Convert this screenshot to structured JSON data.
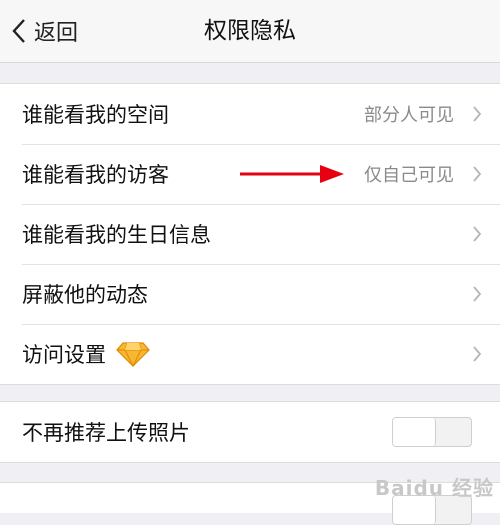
{
  "navbar": {
    "back_label": "返回",
    "title": "权限隐私"
  },
  "group1": [
    {
      "label": "谁能看我的空间",
      "value": "部分人可见"
    },
    {
      "label": "谁能看我的访客",
      "value": "仅自己可见"
    },
    {
      "label": "谁能看我的生日信息",
      "value": ""
    },
    {
      "label": "屏蔽他的动态",
      "value": ""
    },
    {
      "label": "访问设置",
      "value": "",
      "badge_icon": "diamond-icon"
    }
  ],
  "group2": [
    {
      "label": "不再推荐上传照片",
      "toggle": false
    }
  ],
  "annotation": {
    "arrow_color": "#e60012",
    "arrow_target": "仅自己可见"
  },
  "watermark": "Baidu 经验"
}
